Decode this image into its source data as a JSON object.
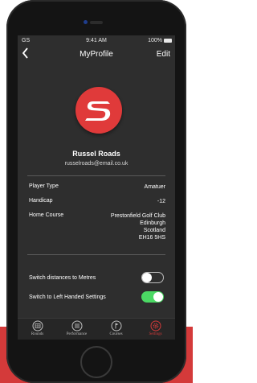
{
  "status": {
    "carrier": "GS",
    "time": "9:41 AM",
    "battery": "100%"
  },
  "nav": {
    "title": "MyProfile",
    "edit_label": "Edit",
    "back_icon": "chevron-left-icon"
  },
  "profile": {
    "name": "Russel Roads",
    "email": "russelroads@email.co.uk"
  },
  "details": [
    {
      "label": "Player Type",
      "value": "Amatuer"
    },
    {
      "label": "Handicap",
      "value": "-12"
    }
  ],
  "home_course": {
    "label": "Home Course",
    "lines": [
      "Prestonfield Golf Club",
      "Edinburgh",
      "Scotland",
      "EH16 5HS"
    ]
  },
  "settings": [
    {
      "label": "Switch distances to Metres",
      "enabled": false
    },
    {
      "label": "Switch to Left Handed Settings",
      "enabled": true
    }
  ],
  "tabs": [
    {
      "label": "Rounds",
      "icon": "scorecard-icon",
      "active": false
    },
    {
      "label": "Performance",
      "icon": "list-icon",
      "active": false
    },
    {
      "label": "Courses",
      "icon": "flag-icon",
      "active": false
    },
    {
      "label": "Settings",
      "icon": "gear-icon",
      "active": true
    }
  ],
  "colors": {
    "accent": "#e03a3a",
    "toggle_on": "#4bd964",
    "tab_inactive": "#bfbfbf",
    "tab_active": "#d23a3a"
  }
}
